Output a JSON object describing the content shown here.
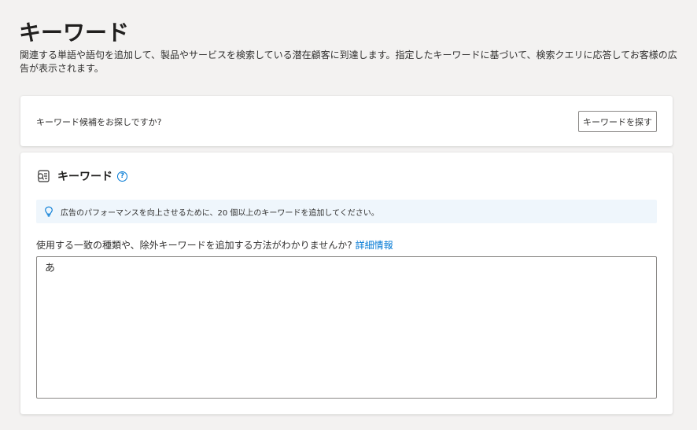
{
  "header": {
    "title": "キーワード",
    "description": "関連する単語や語句を追加して、製品やサービスを検索している潜在顧客に到達します。指定したキーワードに基づいて、検索クエリに応答してお客様の広告が表示されます。"
  },
  "find_card": {
    "question": "キーワード候補をお探しですか?",
    "button_label": "キーワードを探す"
  },
  "keywords_card": {
    "title": "キーワード",
    "help_glyph": "?",
    "tip": "広告のパフォーマンスを向上させるために、20 個以上のキーワードを追加してください。",
    "hint": "使用する一致の種類や、除外キーワードを追加する方法がわかりませんか?",
    "hint_link": "詳細情報",
    "textarea_value": "あ"
  },
  "colors": {
    "accent": "#0078d4",
    "page_background": "#f3f2f1",
    "tip_background": "#eff6fc"
  },
  "icons": {
    "section": "keyword-list-icon",
    "help": "help-circle-icon",
    "tip": "lightbulb-icon"
  }
}
